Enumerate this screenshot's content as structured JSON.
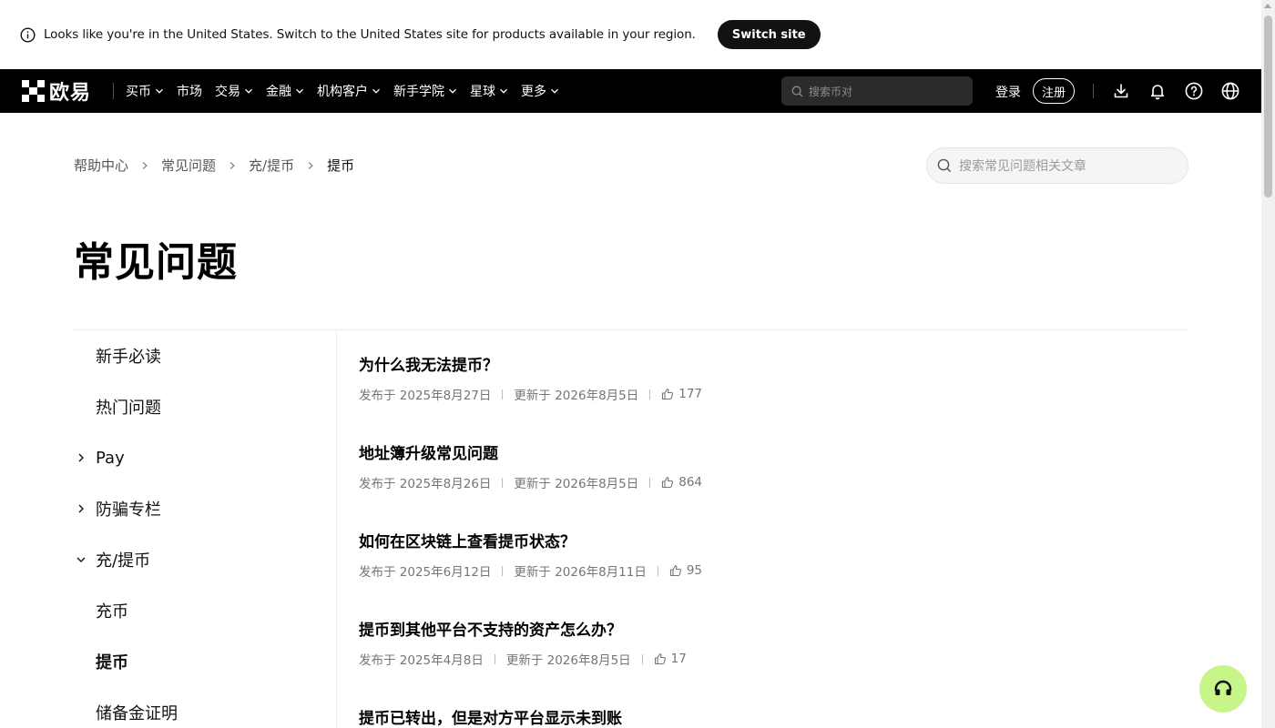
{
  "banner": {
    "message": "Looks like you're in the United States. Switch to the United States site for products available in your region.",
    "switch_label": "Switch site"
  },
  "nav": {
    "brand": "欧易",
    "items": [
      {
        "label": "买币",
        "dropdown": true
      },
      {
        "label": "市场",
        "dropdown": false
      },
      {
        "label": "交易",
        "dropdown": true
      },
      {
        "label": "金融",
        "dropdown": true
      },
      {
        "label": "机构客户",
        "dropdown": true
      },
      {
        "label": "新手学院",
        "dropdown": true
      },
      {
        "label": "星球",
        "dropdown": true
      },
      {
        "label": "更多",
        "dropdown": true
      }
    ],
    "search_placeholder": "搜索币对",
    "login": "登录",
    "register": "注册",
    "icons": [
      "download-icon",
      "bell-icon",
      "help-icon",
      "globe-icon"
    ]
  },
  "breadcrumb": [
    "帮助中心",
    "常见问题",
    "充/提币",
    "提币"
  ],
  "help_search_placeholder": "搜索常见问题相关文章",
  "page_title": "常见问题",
  "sidebar": {
    "items": [
      {
        "label": "新手必读",
        "caret": "none",
        "active": false
      },
      {
        "label": "热门问题",
        "caret": "none",
        "active": false
      },
      {
        "label": "Pay",
        "caret": "right",
        "active": false
      },
      {
        "label": "防骗专栏",
        "caret": "right",
        "active": false
      },
      {
        "label": "充/提币",
        "caret": "down",
        "active": false
      },
      {
        "label": "充币",
        "caret": "none",
        "active": false
      },
      {
        "label": "提币",
        "caret": "none",
        "active": true
      },
      {
        "label": "储备金证明",
        "caret": "none",
        "active": false
      }
    ]
  },
  "articles": [
    {
      "title": "为什么我无法提币？",
      "published": "发布于 2025年8月27日",
      "updated": "更新于 2026年8月5日",
      "likes": "177"
    },
    {
      "title": "地址簿升级常见问题",
      "published": "发布于 2025年8月26日",
      "updated": "更新于 2026年8月5日",
      "likes": "864"
    },
    {
      "title": "如何在区块链上查看提币状态？",
      "published": "发布于 2025年6月12日",
      "updated": "更新于 2026年8月11日",
      "likes": "95"
    },
    {
      "title": "提币到其他平台不支持的资产怎么办？",
      "published": "发布于 2025年4月8日",
      "updated": "更新于 2026年8月5日",
      "likes": "17"
    },
    {
      "title": "提币已转出，但是对方平台显示未到账",
      "published": "",
      "updated": "",
      "likes": ""
    }
  ],
  "colors": {
    "nav_bg": "#000000",
    "support_bg": "#c8f58a",
    "meta_text": "#757575"
  }
}
